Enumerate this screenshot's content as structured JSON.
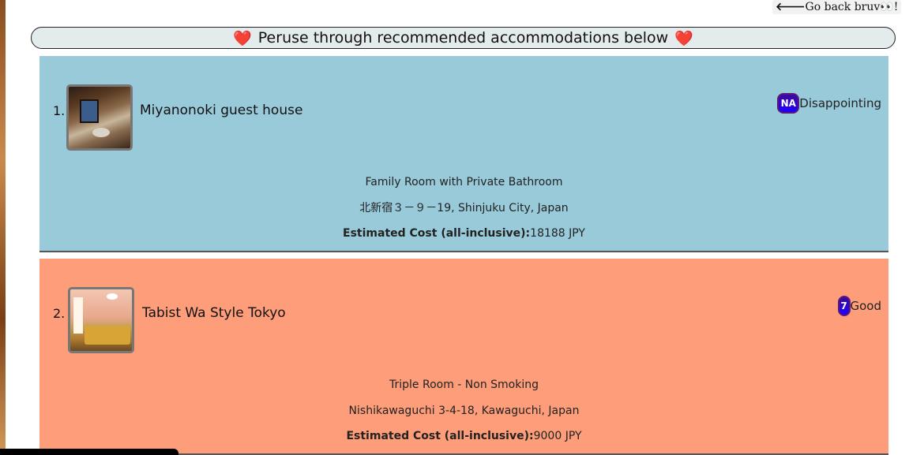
{
  "back_link": {
    "arrow": "🡐",
    "label": "Go back bruv👀!"
  },
  "banner": {
    "heart_left": "❤️",
    "title": "Peruse through recommended accommodations below",
    "heart_right": "❤️"
  },
  "accommodations": [
    {
      "rank": "1.",
      "name": "Miyanonoki guest house",
      "rating_badge": "NA",
      "rating_label": "Disappointing",
      "room": "Family Room with Private Bathroom",
      "address": "北新宿３－９－19, Shinjuku City, Japan",
      "cost_label": "Estimated Cost (all-inclusive):",
      "cost_value": "18188 JPY",
      "background": "#99cad9"
    },
    {
      "rank": "2.",
      "name": "Tabist Wa Style Tokyo",
      "rating_badge": "7",
      "rating_label": "Good",
      "room": "Triple Room - Non Smoking",
      "address": "Nishikawaguchi 3-4-18, Kawaguchi, Japan",
      "cost_label": "Estimated Cost (all-inclusive):",
      "cost_value": "9000 JPY",
      "background": "#fe9d7a"
    }
  ],
  "colors": {
    "banner_bg": "#e3ebec",
    "badge_bg": "#1e00ff",
    "heart": "#e3001b"
  }
}
